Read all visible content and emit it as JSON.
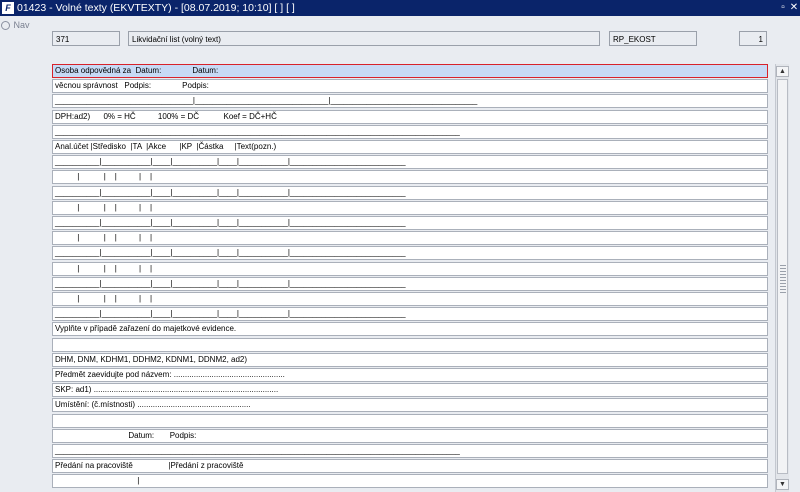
{
  "window": {
    "title": "01423 - Volné texty (EKVTEXTY) - [08.07.2019; 10:10]  [ ]  [ ]",
    "restore_glyph": "▫",
    "close_glyph": "✕"
  },
  "nav": {
    "label": "Nav"
  },
  "header": {
    "code": "371",
    "name": "Likvidační list (volný text)",
    "module": "RP_EKOST",
    "page": "1"
  },
  "rows": [
    "Osoba odpovědná za  Datum:              Datum:",
    "věcnou správnost   Podpis:              Podpis:",
    "_______________________________|______________________________|_________________________________",
    "DPH:ad2)      0% = HČ          100% = DČ           Koef = DČ+HČ",
    "___________________________________________________________________________________________",
    "Anal.účet |Středisko  |TA  |Akce      |KP  |Částka     |Text(pozn.)",
    "__________|___________|____|__________|____|___________|__________________________",
    "          |           |    |          |    |",
    "__________|___________|____|__________|____|___________|__________________________",
    "          |           |    |          |    |",
    "__________|___________|____|__________|____|___________|__________________________",
    "          |           |    |          |    |",
    "__________|___________|____|__________|____|___________|__________________________",
    "          |           |    |          |    |",
    "__________|___________|____|__________|____|___________|__________________________",
    "          |           |    |          |    |",
    "__________|___________|____|__________|____|___________|__________________________",
    "Vyplňte v případě zařazení do majetkové evidence.",
    "",
    "DHM, DNM, KDHM1, DDHM2, KDNM1, DDNM2, ad2)",
    "Předmět zaevidujte pod názvem: ..................................................",
    "SKP: ad1) ...................................................................................",
    "Umístění: (č.místnosti) ...................................................",
    "",
    "                                 Datum:       Podpis:",
    "___________________________________________________________________________________________",
    "Předání na pracoviště                |Předání z pracoviště",
    "                                     |"
  ],
  "scrollbar": {
    "up_glyph": "▲",
    "down_glyph": "▼"
  }
}
